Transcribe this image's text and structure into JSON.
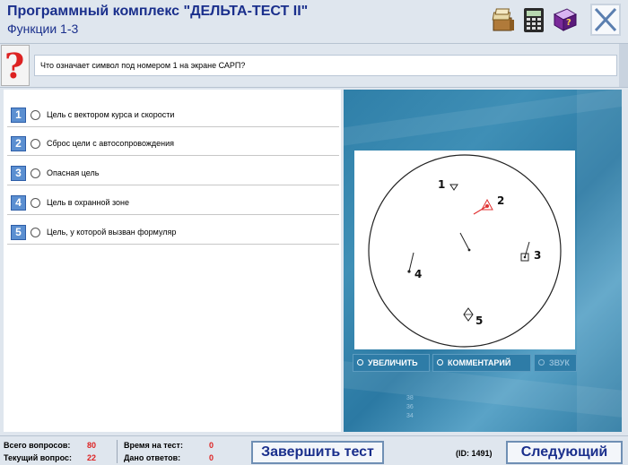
{
  "header": {
    "title": "Программный комплекс \"ДЕЛЬТА-ТЕСТ II\"",
    "subtitle": "Функции 1-3",
    "icons": [
      "book-stack-icon",
      "calculator-icon",
      "help-book-icon",
      "close-icon"
    ]
  },
  "question": {
    "icon": "question-mark-icon",
    "text": "Что означает символ под номером 1 на экране САРП?"
  },
  "answers": [
    {
      "num": "1",
      "label": "Цель с вектором курса и скорости"
    },
    {
      "num": "2",
      "label": "Сброс цели с автосопровождения"
    },
    {
      "num": "3",
      "label": "Опасная цель"
    },
    {
      "num": "4",
      "label": "Цель в охранной зоне"
    },
    {
      "num": "5",
      "label": "Цель, у которой вызван формуляр"
    }
  ],
  "media": {
    "radar_labels": [
      "1",
      "2",
      "3",
      "4",
      "5"
    ],
    "buttons": {
      "zoom": "УВЕЛИЧИТЬ",
      "comment": "КОММЕНТАРИЙ",
      "sound": "ЗВУК"
    },
    "bg_numbers": [
      "38",
      "36",
      "34"
    ]
  },
  "status": {
    "total_label": "Всего вопросов:",
    "total_value": "80",
    "current_label": "Текущий вопрос:",
    "current_value": "22",
    "time_label": "Время на тест:",
    "time_value": "0",
    "answered_label": "Дано ответов:",
    "answered_value": "0",
    "finish_label": "Завершить тест",
    "id_label": "(ID: 1491)",
    "next_label": "Следующий"
  },
  "colors": {
    "title_blue": "#1a2f8c",
    "accent_red": "#dd2222",
    "media_blue": "#2f7fa8"
  }
}
